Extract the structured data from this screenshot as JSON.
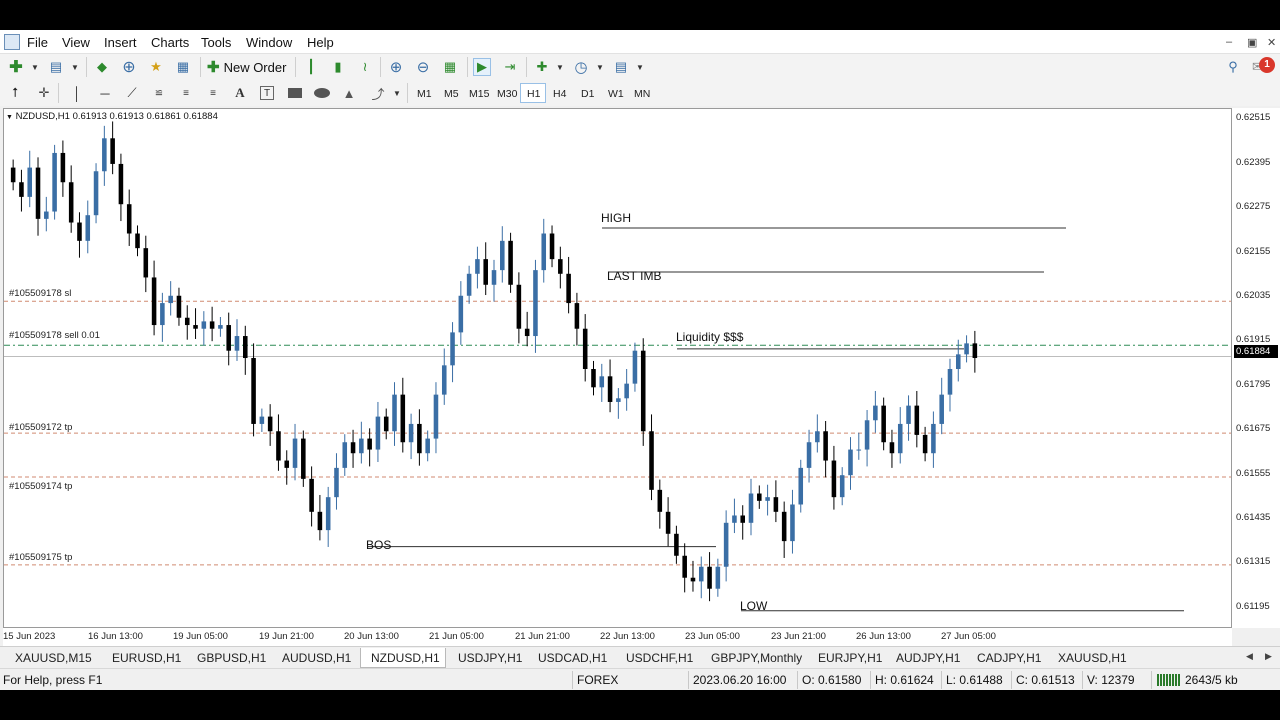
{
  "menu": [
    "File",
    "View",
    "Insert",
    "Charts",
    "Tools",
    "Window",
    "Help"
  ],
  "toolbar": {
    "new_order_label": "New Order",
    "notification_count": "1"
  },
  "timeframes": [
    "M1",
    "M5",
    "M15",
    "M30",
    "H1",
    "H4",
    "D1",
    "W1",
    "MN"
  ],
  "active_timeframe": "H1",
  "chart": {
    "header": "NZDUSD,H1  0.61913 0.61913 0.61861 0.61884",
    "price_ticks": [
      "0.62515",
      "0.62395",
      "0.62275",
      "0.62155",
      "0.62035",
      "0.61915",
      "0.61795",
      "0.61675",
      "0.61555",
      "0.61435",
      "0.61315",
      "0.61195"
    ],
    "current_price": "0.61884",
    "time_ticks": [
      "15 Jun 2023",
      "16 Jun 13:00",
      "19 Jun 05:00",
      "19 Jun 21:00",
      "20 Jun 13:00",
      "21 Jun 05:00",
      "21 Jun 21:00",
      "22 Jun 13:00",
      "23 Jun 05:00",
      "23 Jun 21:00",
      "26 Jun 13:00",
      "27 Jun 05:00"
    ],
    "order_labels": [
      "#105509178 sl",
      "#105509178 sell 0.01",
      "#105509172 tp",
      "#105509174 tp",
      "#105509175 tp"
    ],
    "annotations": [
      "HIGH",
      "LAST IMB",
      "Liquidity $$$",
      "BOS",
      "LOW"
    ],
    "colors": {
      "bull": "#3a6ea5",
      "bear": "#000000",
      "sl_line": "#d08a70",
      "entry_line": "#2e8b57",
      "level_line": "#303030"
    }
  },
  "tabs": [
    "XAUUSD,M15",
    "EURUSD,H1",
    "GBPUSD,H1",
    "AUDUSD,H1",
    "NZDUSD,H1",
    "USDJPY,H1",
    "USDCAD,H1",
    "USDCHF,H1",
    "GBPJPY,Monthly",
    "EURJPY,H1",
    "AUDJPY,H1",
    "CADJPY,H1",
    "XAUUSD,H1"
  ],
  "active_tab": "NZDUSD,H1",
  "status": {
    "help": "For Help, press F1",
    "profile": "FOREX",
    "datetime": "2023.06.20 16:00",
    "open": "O: 0.61580",
    "high": "H: 0.61624",
    "low": "L: 0.61488",
    "close": "C: 0.61513",
    "volume": "V: 12379",
    "traffic": "2643/5 kb"
  },
  "chart_data": {
    "type": "candlestick",
    "symbol": "NZDUSD",
    "timeframe": "H1",
    "y_range": [
      0.6114,
      0.6256
    ],
    "closes": [
      0.6236,
      0.6232,
      0.624,
      0.6226,
      0.6228,
      0.6244,
      0.6236,
      0.6225,
      0.622,
      0.6227,
      0.6239,
      0.6248,
      0.6241,
      0.623,
      0.6222,
      0.6218,
      0.621,
      0.6197,
      0.6203,
      0.6205,
      0.6199,
      0.6197,
      0.6196,
      0.6198,
      0.6196,
      0.6197,
      0.619,
      0.6194,
      0.6188,
      0.617,
      0.6172,
      0.6168,
      0.616,
      0.6158,
      0.6166,
      0.6155,
      0.6146,
      0.6141,
      0.615,
      0.6158,
      0.6165,
      0.6162,
      0.6166,
      0.6163,
      0.6172,
      0.6168,
      0.6178,
      0.6165,
      0.617,
      0.6162,
      0.6166,
      0.6178,
      0.6186,
      0.6195,
      0.6205,
      0.6211,
      0.6215,
      0.6208,
      0.6212,
      0.622,
      0.6208,
      0.6196,
      0.6194,
      0.6212,
      0.6222,
      0.6215,
      0.6211,
      0.6203,
      0.6196,
      0.6185,
      0.618,
      0.6183,
      0.6176,
      0.6177,
      0.6181,
      0.619,
      0.6168,
      0.6152,
      0.6146,
      0.614,
      0.6134,
      0.6128,
      0.6127,
      0.6131,
      0.6125,
      0.6131,
      0.6143,
      0.6145,
      0.6143,
      0.6151,
      0.6149,
      0.615,
      0.6146,
      0.6138,
      0.6148,
      0.6158,
      0.6165,
      0.6168,
      0.616,
      0.615,
      0.6156,
      0.6163,
      0.6163,
      0.6171,
      0.6175,
      0.6165,
      0.6162,
      0.617,
      0.6175,
      0.6167,
      0.6162,
      0.617,
      0.6178,
      0.6185,
      0.6189,
      0.6192,
      0.6188
    ]
  }
}
